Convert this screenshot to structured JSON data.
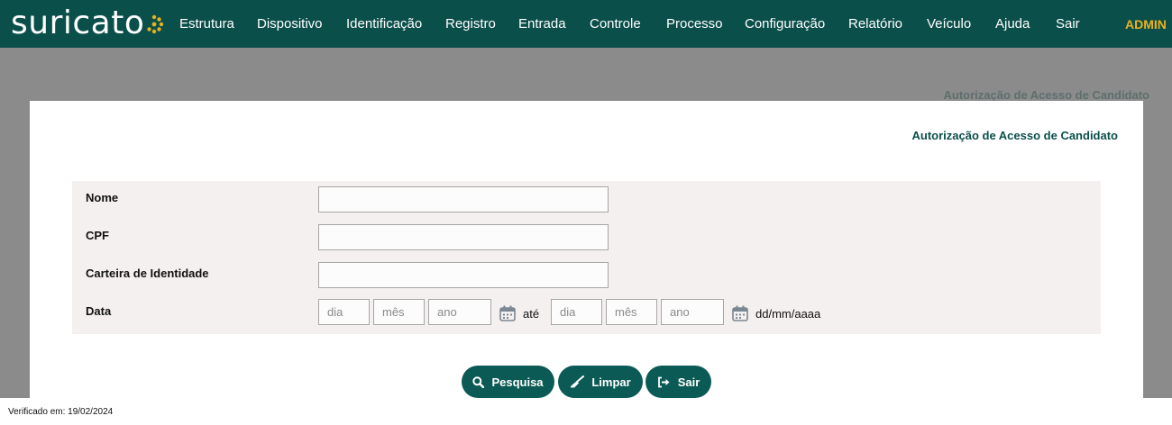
{
  "brand": {
    "name": "suricato"
  },
  "nav": {
    "items": [
      "Estrutura",
      "Dispositivo",
      "Identificação",
      "Registro",
      "Entrada",
      "Controle",
      "Processo",
      "Configuração",
      "Relatório",
      "Veículo",
      "Ajuda",
      "Sair"
    ],
    "user": "ADMIN"
  },
  "page": {
    "background_title": "Autorização de Acesso de Candidato",
    "title": "Autorização de Acesso de Candidato"
  },
  "form": {
    "nome_label": "Nome",
    "nome_value": "",
    "cpf_label": "CPF",
    "cpf_value": "",
    "rg_label": "Carteira de Identidade",
    "rg_value": "",
    "data_label": "Data",
    "date_from": {
      "day_placeholder": "dia",
      "month_placeholder": "mês",
      "year_placeholder": "ano"
    },
    "date_separator": "até",
    "date_to": {
      "day_placeholder": "dia",
      "month_placeholder": "mês",
      "year_placeholder": "ano"
    },
    "date_format_hint": "dd/mm/aaaa"
  },
  "buttons": {
    "search": "Pesquisa",
    "clear": "Limpar",
    "exit": "Sair"
  },
  "footer": {
    "verified": "Verificado em: 19/02/2024"
  },
  "colors": {
    "navbar": "#0b4f4a",
    "accent": "#e8b21f",
    "button": "#0b5a55"
  }
}
